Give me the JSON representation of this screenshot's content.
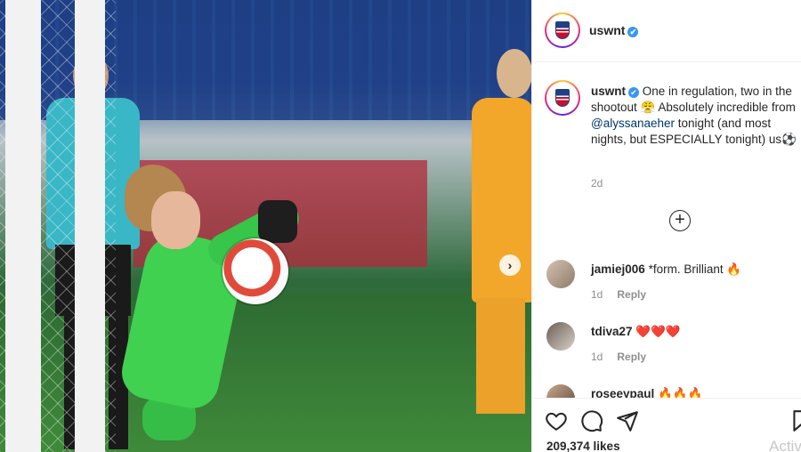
{
  "post": {
    "username": "uswnt",
    "verified_glyph": "✔",
    "next_arrow": "›"
  },
  "caption": {
    "username": "uswnt",
    "text_1": "One in regulation, two in the shootout 😤 Absolutely incredible from ",
    "mention": "@alyssanaeher",
    "text_2": " tonight (and most nights, but ESPECIALLY tonight) us⚽",
    "time": "2d"
  },
  "load_more": {
    "icon": "plus-circle-icon",
    "glyph": "+"
  },
  "comments": [
    {
      "username": "jamiej006",
      "text": "*form. Brilliant 🔥",
      "time": "1d",
      "reply": "Reply"
    },
    {
      "username": "tdiva27",
      "text": "❤️❤️❤️",
      "time": "1d",
      "reply": "Reply"
    },
    {
      "username": "roseeypaul",
      "text": "🔥🔥🔥",
      "time": "",
      "reply": ""
    }
  ],
  "actions": {
    "icons": [
      "heart-icon",
      "comment-icon",
      "share-icon",
      "bookmark-icon"
    ],
    "likes": "209,374 likes",
    "watermark": "Activ"
  },
  "colors": {
    "link": "#00376b",
    "verified": "#3897f0",
    "muted": "#8e8e8e"
  }
}
